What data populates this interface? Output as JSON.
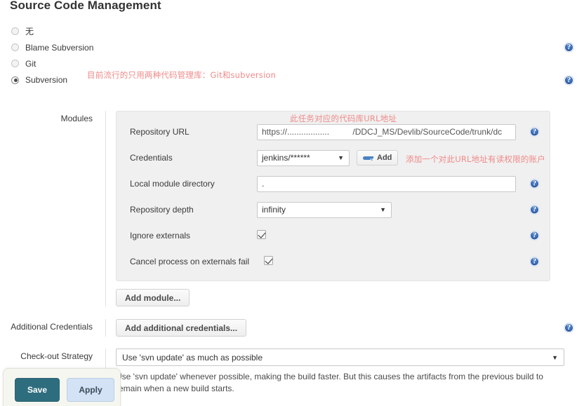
{
  "page": {
    "title": "Source Code Management"
  },
  "scm": {
    "options": [
      {
        "label": "无",
        "selected": false,
        "cjk": true,
        "help": false
      },
      {
        "label": "Blame Subversion",
        "selected": false,
        "cjk": false,
        "help": true
      },
      {
        "label": "Git",
        "selected": false,
        "cjk": false,
        "help": false
      },
      {
        "label": "Subversion",
        "selected": true,
        "cjk": false,
        "help": true
      }
    ]
  },
  "annotations": {
    "scm_note": "目前流行的只用两种代码管理库：Git和subversion",
    "repo_url_note": "此任务对应的代码库URL地址",
    "credentials_note": "添加一个对此URL地址有读权限的账户"
  },
  "modules": {
    "left_label": "Modules",
    "add_module_label": "Add module...",
    "rows": {
      "repository_url": {
        "label": "Repository URL",
        "value": "https://..................          /DDCJ_MS/Devlib/SourceCode/trunk/dc"
      },
      "credentials": {
        "label": "Credentials",
        "value": "jenkins/******",
        "add_button_label": "Add"
      },
      "local_module_directory": {
        "label": "Local module directory",
        "value": "."
      },
      "repository_depth": {
        "label": "Repository depth",
        "value": "infinity"
      },
      "ignore_externals": {
        "label": "Ignore externals",
        "checked": true
      },
      "cancel_process_on_externals_fail": {
        "label": "Cancel process on externals fail",
        "checked": true
      }
    }
  },
  "additional_credentials": {
    "label": "Additional Credentials",
    "button_label": "Add additional credentials..."
  },
  "checkout_strategy": {
    "label": "Check-out Strategy",
    "value": "Use 'svn update' as much as possible",
    "description": "Use 'svn update' whenever possible, making the build faster. But this causes the artifacts from the previous build to remain when a new build starts."
  },
  "savebar": {
    "save_label": "Save",
    "apply_label": "Apply"
  },
  "icons": {
    "help": "help-icon",
    "caret": "▼",
    "key": "key-icon"
  },
  "colors": {
    "save_button": "#2e6d7e",
    "apply_button": "#d3e3f5",
    "annotation_red": "#f08a8a",
    "help_blue": "#2f5ea8",
    "panel_bg": "#f0f0f0"
  }
}
